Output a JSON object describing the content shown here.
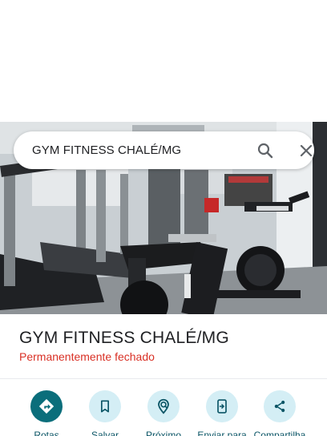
{
  "search": {
    "query": "GYM FITNESS CHALÉ/MG"
  },
  "place": {
    "title": "GYM FITNESS CHALÉ/MG",
    "status": "Permanentemente fechado"
  },
  "actions": [
    {
      "label": "Rotas",
      "icon": "directions-icon"
    },
    {
      "label": "Salvar",
      "icon": "bookmark-icon"
    },
    {
      "label": "Próximo",
      "icon": "nearby-icon"
    },
    {
      "label": "Enviar para",
      "icon": "send-to-phone-icon"
    },
    {
      "label": "Compartilha",
      "icon": "share-icon"
    }
  ],
  "colors": {
    "status_red": "#d93025",
    "accent_teal": "#0b6e7b",
    "action_bg": "#d4eef5"
  }
}
